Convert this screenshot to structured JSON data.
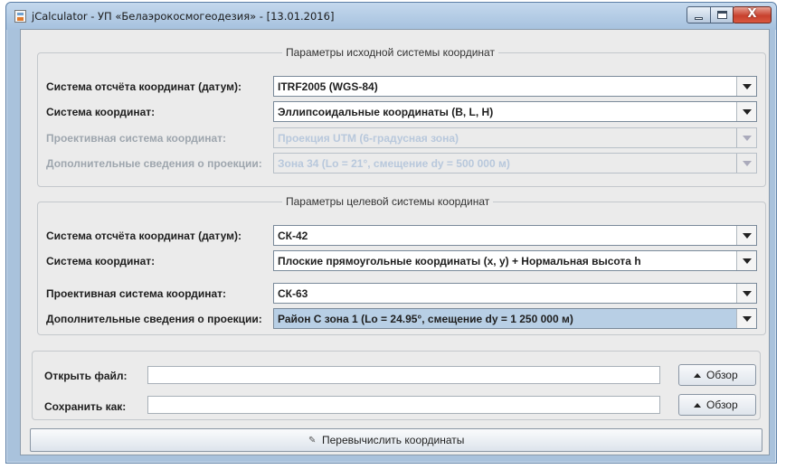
{
  "window": {
    "title": "jCalculator - УП «Белаэрокосмогеодезия» - [13.01.2016]",
    "close_glyph": "X"
  },
  "source_group": {
    "legend": "Параметры исходной системы координат",
    "rows": [
      {
        "label": "Система отсчёта координат (датум):",
        "value": "ITRF2005 (WGS-84)",
        "enabled": true
      },
      {
        "label": "Система координат:",
        "value": "Эллипсоидальные координаты (B, L, H)",
        "enabled": true
      },
      {
        "label": "Проективная система координат:",
        "value": "Проекция UTM (6-градусная зона)",
        "enabled": false
      },
      {
        "label": "Дополнительные сведения о проекции:",
        "value": "Зона 34 (Lo = 21°, смещение dy = 500 000 м)",
        "enabled": false
      }
    ]
  },
  "target_group": {
    "legend": "Параметры целевой системы координат",
    "rows": [
      {
        "label": "Система отсчёта координат (датум):",
        "value": "СК-42",
        "enabled": true
      },
      {
        "label": "Система координат:",
        "value": "Плоские прямоугольные координаты (x, y) + Нормальная высота h",
        "enabled": true
      },
      {
        "label": "Проективная система координат:",
        "value": "СК-63",
        "enabled": true
      },
      {
        "label": "Дополнительные сведения о проекции:",
        "value": "Район С зона 1 (Lo = 24.95°, смещение dy = 1 250 000 м)",
        "enabled": true,
        "focused": true
      }
    ]
  },
  "files": {
    "open_label": "Открыть файл:",
    "open_value": "",
    "save_label": "Сохранить как:",
    "save_value": "",
    "browse_label": "Обзор"
  },
  "recalculate_label": "Перевычислить координаты",
  "icons": {
    "app": "java-app-icon",
    "browse": "arrow-up-icon",
    "recalculate": "pencil-icon",
    "dropdown": "dropdown-arrow-icon"
  },
  "colors": {
    "window_frame": "#a9c2dc",
    "panel_bg": "#ebebeb",
    "focused_combo": "#b8cfe5",
    "disabled_text": "#9ea6ae",
    "close_button": "#c8412e"
  }
}
